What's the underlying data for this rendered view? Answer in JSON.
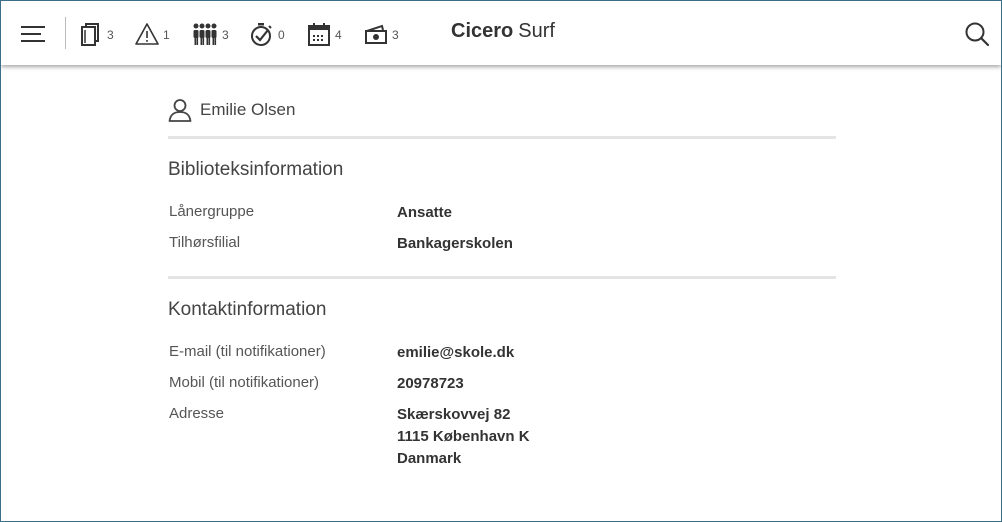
{
  "header": {
    "brand_bold": "Cicero",
    "brand_regular": "Surf",
    "counters": [
      {
        "icon": "loans-icon",
        "count": "3"
      },
      {
        "icon": "warning-icon",
        "count": "1"
      },
      {
        "icon": "reservations-icon",
        "count": "3"
      },
      {
        "icon": "overdue-icon",
        "count": "0"
      },
      {
        "icon": "calendar-icon",
        "count": "4"
      },
      {
        "icon": "fees-icon",
        "count": "3"
      }
    ]
  },
  "user": {
    "name": "Emilie Olsen"
  },
  "library_info": {
    "title": "Biblioteksinformation",
    "rows": [
      {
        "label": "Lånergruppe",
        "value": "Ansatte"
      },
      {
        "label": "Tilhørsfilial",
        "value": "Bankagerskolen"
      }
    ]
  },
  "contact_info": {
    "title": "Kontaktinformation",
    "email_label": "E-mail (til notifikationer)",
    "email_value": "emilie@skole.dk",
    "mobile_label": "Mobil (til notifikationer)",
    "mobile_value": "20978723",
    "address_label": "Adresse",
    "address_lines": [
      "Skærskovvej 82",
      "1115 København K",
      "Danmark"
    ]
  },
  "colors": {
    "frame_border": "#3d6e8a",
    "divider": "#e4e4e4",
    "text": "#333333"
  }
}
